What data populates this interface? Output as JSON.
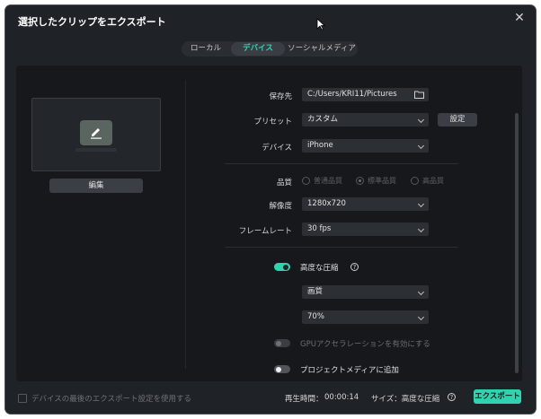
{
  "window": {
    "title": "選択したクリップをエクスポート"
  },
  "tabs": [
    {
      "label": "ローカル"
    },
    {
      "label": "デバイス"
    },
    {
      "label": "ソーシャルメディア"
    }
  ],
  "left": {
    "edit_label": "編集"
  },
  "form": {
    "save_to": {
      "label": "保存先",
      "value": "C:/Users/KRI11/Pictures"
    },
    "preset": {
      "label": "プリセット",
      "value": "カスタム",
      "settings_label": "設定"
    },
    "device": {
      "label": "デバイス",
      "value": "iPhone"
    },
    "quality": {
      "label": "品質",
      "options": [
        "普通品質",
        "標準品質",
        "高品質"
      ],
      "selected": "標準品質"
    },
    "resolution": {
      "label": "解像度",
      "value": "1280x720"
    },
    "framerate": {
      "label": "フレームレート",
      "value": "30 fps"
    },
    "compression": {
      "label": "高度な圧縮",
      "enabled": true,
      "mode": "画質",
      "level": "70%"
    },
    "gpu": {
      "label": "GPUアクセラレーションを有効にする",
      "enabled": false
    },
    "project_media": {
      "label": "プロジェクトメディアに追加",
      "enabled": false
    }
  },
  "footer": {
    "use_last_settings": "デバイスの最後のエクスポート設定を使用する",
    "duration_label": "再生時間：",
    "duration_value": "00:00:14",
    "size_label": "サイズ：高度な圧縮",
    "export_label": "エクスポート"
  },
  "colors": {
    "accent": "#2fd3b0",
    "background": "#1f2227",
    "panel": "#16181c"
  }
}
